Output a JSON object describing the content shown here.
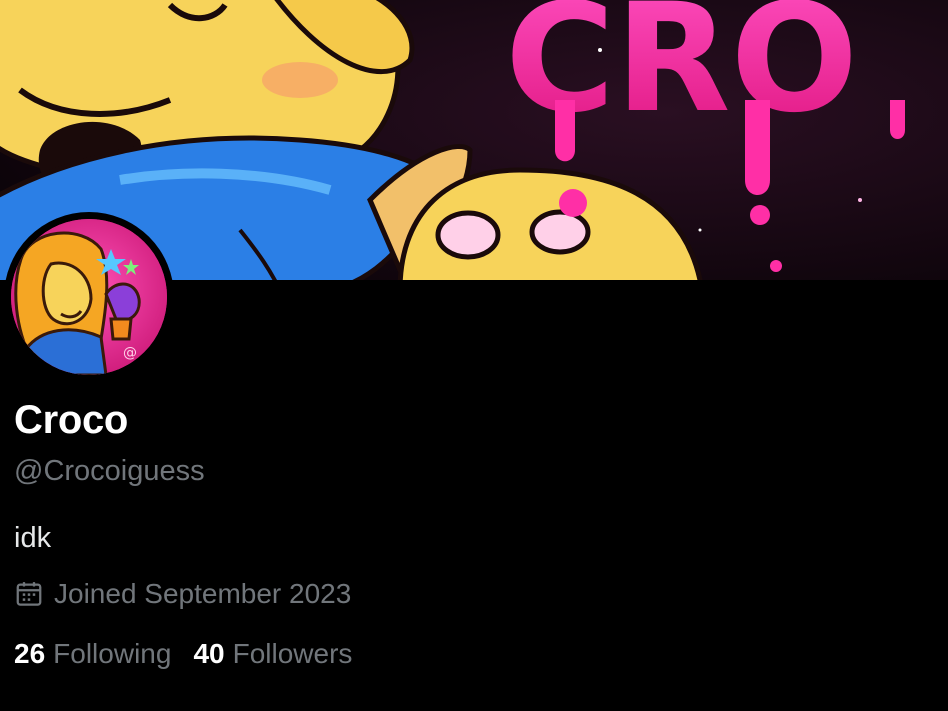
{
  "banner": {
    "text": "CRO"
  },
  "profile": {
    "display_name": "Croco",
    "handle": "@Crocoiguess",
    "bio": "idk",
    "joined": "Joined September 2023",
    "following_count": "26",
    "following_label": "Following",
    "followers_count": "40",
    "followers_label": "Followers"
  },
  "icons": {
    "joined": "calendar-icon"
  },
  "colors": {
    "background": "#000000",
    "primary_text": "#ffffff",
    "secondary_text": "#71767b",
    "banner_pink": "#ff2fa6"
  }
}
